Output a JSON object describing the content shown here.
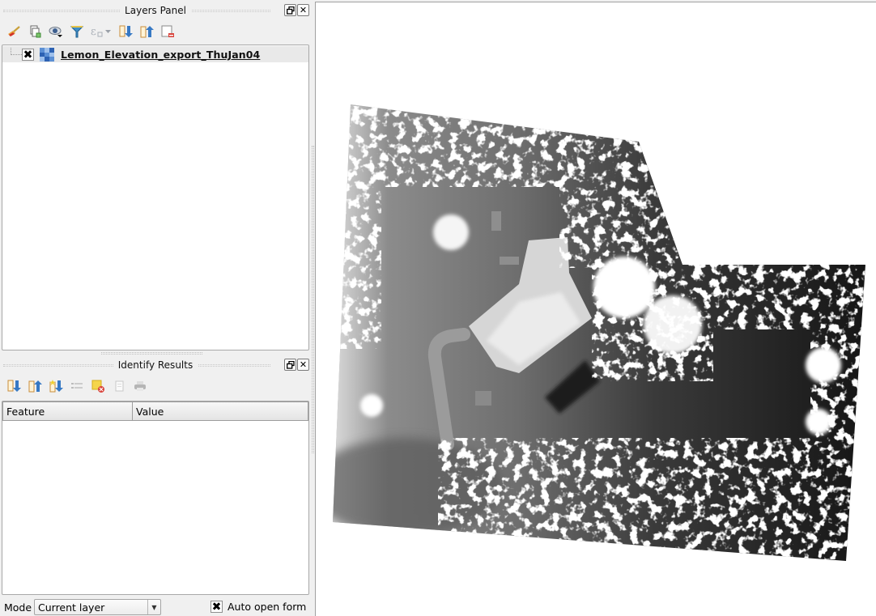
{
  "layers_panel": {
    "title": "Layers Panel",
    "float_button": "🗗",
    "close_button": "✕",
    "toolbar": [
      {
        "icon": "style-manager-icon",
        "tooltip": "Open Layer Styling"
      },
      {
        "icon": "add-group-icon",
        "tooltip": "Add Group"
      },
      {
        "icon": "visibility-eye-icon",
        "tooltip": "Manage Map Themes"
      },
      {
        "icon": "filter-legend-icon",
        "tooltip": "Filter Legend"
      },
      {
        "icon": "filter-expression-icon",
        "tooltip": "Filter by Expression"
      },
      {
        "icon": "expand-all-icon",
        "tooltip": "Expand All"
      },
      {
        "icon": "collapse-all-icon",
        "tooltip": "Collapse All"
      },
      {
        "icon": "remove-layer-icon",
        "tooltip": "Remove Layer"
      }
    ],
    "layers": [
      {
        "name": "Lemon_Elevation_export_ThuJan04",
        "checked": true,
        "checkbox_glyph": "✖",
        "type": "raster"
      }
    ]
  },
  "identify_panel": {
    "title": "Identify Results",
    "float_button": "🗗",
    "close_button": "✕",
    "toolbar": [
      {
        "icon": "expand-tree-icon"
      },
      {
        "icon": "collapse-tree-icon"
      },
      {
        "icon": "expand-new-results-icon"
      },
      {
        "icon": "form-view-icon"
      },
      {
        "icon": "clear-highlights-icon"
      },
      {
        "icon": "copy-feature-icon"
      },
      {
        "icon": "print-icon"
      }
    ],
    "columns": [
      "Feature",
      "Value"
    ],
    "rows": [],
    "mode_label": "Mode",
    "mode_value": "Current layer",
    "mode_arrow": "▼",
    "auto_open_form_label": "Auto open form",
    "auto_open_form_checked": true,
    "auto_open_form_glyph": "✖"
  },
  "map": {
    "layer_name": "Lemon_Elevation_export_ThuJan04",
    "render": "grayscale elevation raster"
  }
}
